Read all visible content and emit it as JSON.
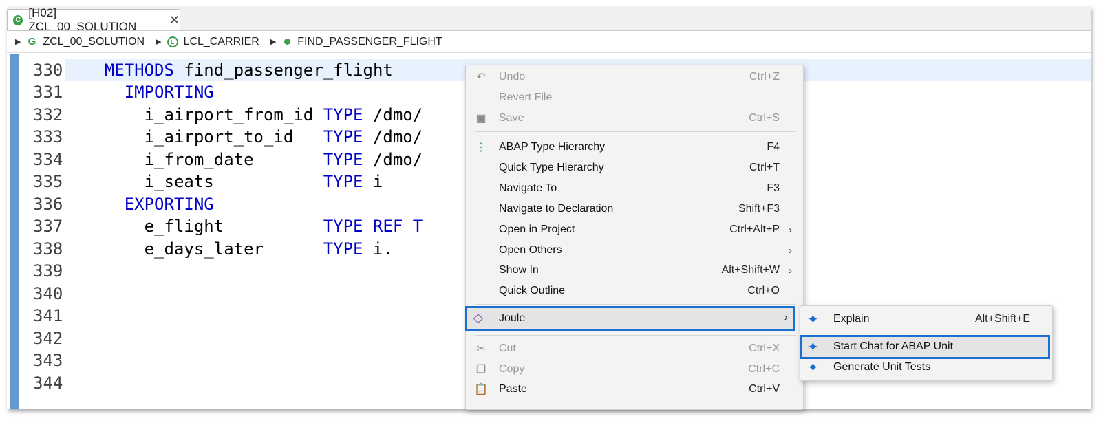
{
  "tab": {
    "title": "[H02] ZCL_00_SOLUTION",
    "close_glyph": "✕",
    "icon": "class-icon"
  },
  "breadcrumb": {
    "items": [
      {
        "label": "ZCL_00_SOLUTION",
        "icon": "global-class-icon"
      },
      {
        "label": "LCL_CARRIER",
        "icon": "local-class-icon"
      },
      {
        "label": "FIND_PASSENGER_FLIGHT",
        "icon": "method-icon"
      }
    ]
  },
  "editor": {
    "line_numbers": [
      "330",
      "331",
      "332",
      "333",
      "334",
      "335",
      "336",
      "337",
      "338",
      "339",
      "340",
      "341",
      "342",
      "343",
      "344"
    ],
    "lines": [
      {
        "indent": "    ",
        "kw": "METHODS",
        "tx": " find_passenger_flight"
      },
      {
        "indent": "      ",
        "kw": "IMPORTING",
        "tx": ""
      },
      {
        "indent": "        ",
        "tx": "i_airport_from_id ",
        "kw": "TYPE",
        "tx2": " /dmo/"
      },
      {
        "indent": "        ",
        "tx": "i_airport_to_id   ",
        "kw": "TYPE",
        "tx2": " /dmo/"
      },
      {
        "indent": "        ",
        "tx": "i_from_date       ",
        "kw": "TYPE",
        "tx2": " /dmo/"
      },
      {
        "indent": "        ",
        "tx": "i_seats           ",
        "kw": "TYPE",
        "tx2": " i"
      },
      {
        "indent": "      ",
        "kw": "EXPORTING",
        "tx": ""
      },
      {
        "indent": "        ",
        "tx": "e_flight          ",
        "kw": "TYPE REF T",
        "tx2": ""
      },
      {
        "indent": "        ",
        "tx": "e_days_later      ",
        "kw": "TYPE",
        "tx2": " i."
      }
    ]
  },
  "context_menu": {
    "items": [
      {
        "label": "Undo",
        "shortcut": "Ctrl+Z",
        "disabled": true,
        "icon": "undo-icon"
      },
      {
        "label": "Revert File",
        "shortcut": "",
        "disabled": true
      },
      {
        "label": "Save",
        "shortcut": "Ctrl+S",
        "disabled": true,
        "icon": "save-icon"
      },
      {
        "label": "ABAP Type Hierarchy",
        "shortcut": "F4",
        "icon": "hierarchy-icon"
      },
      {
        "label": "Quick Type Hierarchy",
        "shortcut": "Ctrl+T"
      },
      {
        "label": "Navigate To",
        "shortcut": "F3"
      },
      {
        "label": "Navigate to Declaration",
        "shortcut": "Shift+F3"
      },
      {
        "label": "Open in Project",
        "shortcut": "Ctrl+Alt+P",
        "submenu": true
      },
      {
        "label": "Open Others",
        "shortcut": "",
        "submenu": true
      },
      {
        "label": "Show In",
        "shortcut": "Alt+Shift+W",
        "submenu": true
      },
      {
        "label": "Quick Outline",
        "shortcut": "Ctrl+O"
      },
      {
        "label": "Joule",
        "shortcut": "",
        "submenu": true,
        "icon": "joule-icon",
        "highlighted": true
      },
      {
        "label": "Cut",
        "shortcut": "Ctrl+X",
        "disabled": true,
        "icon": "cut-icon"
      },
      {
        "label": "Copy",
        "shortcut": "Ctrl+C",
        "disabled": true,
        "icon": "copy-icon"
      },
      {
        "label": "Paste",
        "shortcut": "Ctrl+V",
        "icon": "paste-icon"
      }
    ],
    "submenu_arrow": "›"
  },
  "joule_submenu": {
    "items": [
      {
        "label": "Explain",
        "shortcut": "Alt+Shift+E",
        "icon": "sparkle-icon"
      },
      {
        "label": "Start Chat for ABAP Unit",
        "shortcut": "",
        "icon": "sparkle-icon",
        "highlighted": true
      },
      {
        "label": "Generate Unit Tests",
        "shortcut": "",
        "icon": "sparkle-icon"
      }
    ]
  },
  "colors": {
    "keyword": "#0000c8",
    "highlight_border": "#1a6fd0",
    "current_line": "#e8f2fe"
  }
}
